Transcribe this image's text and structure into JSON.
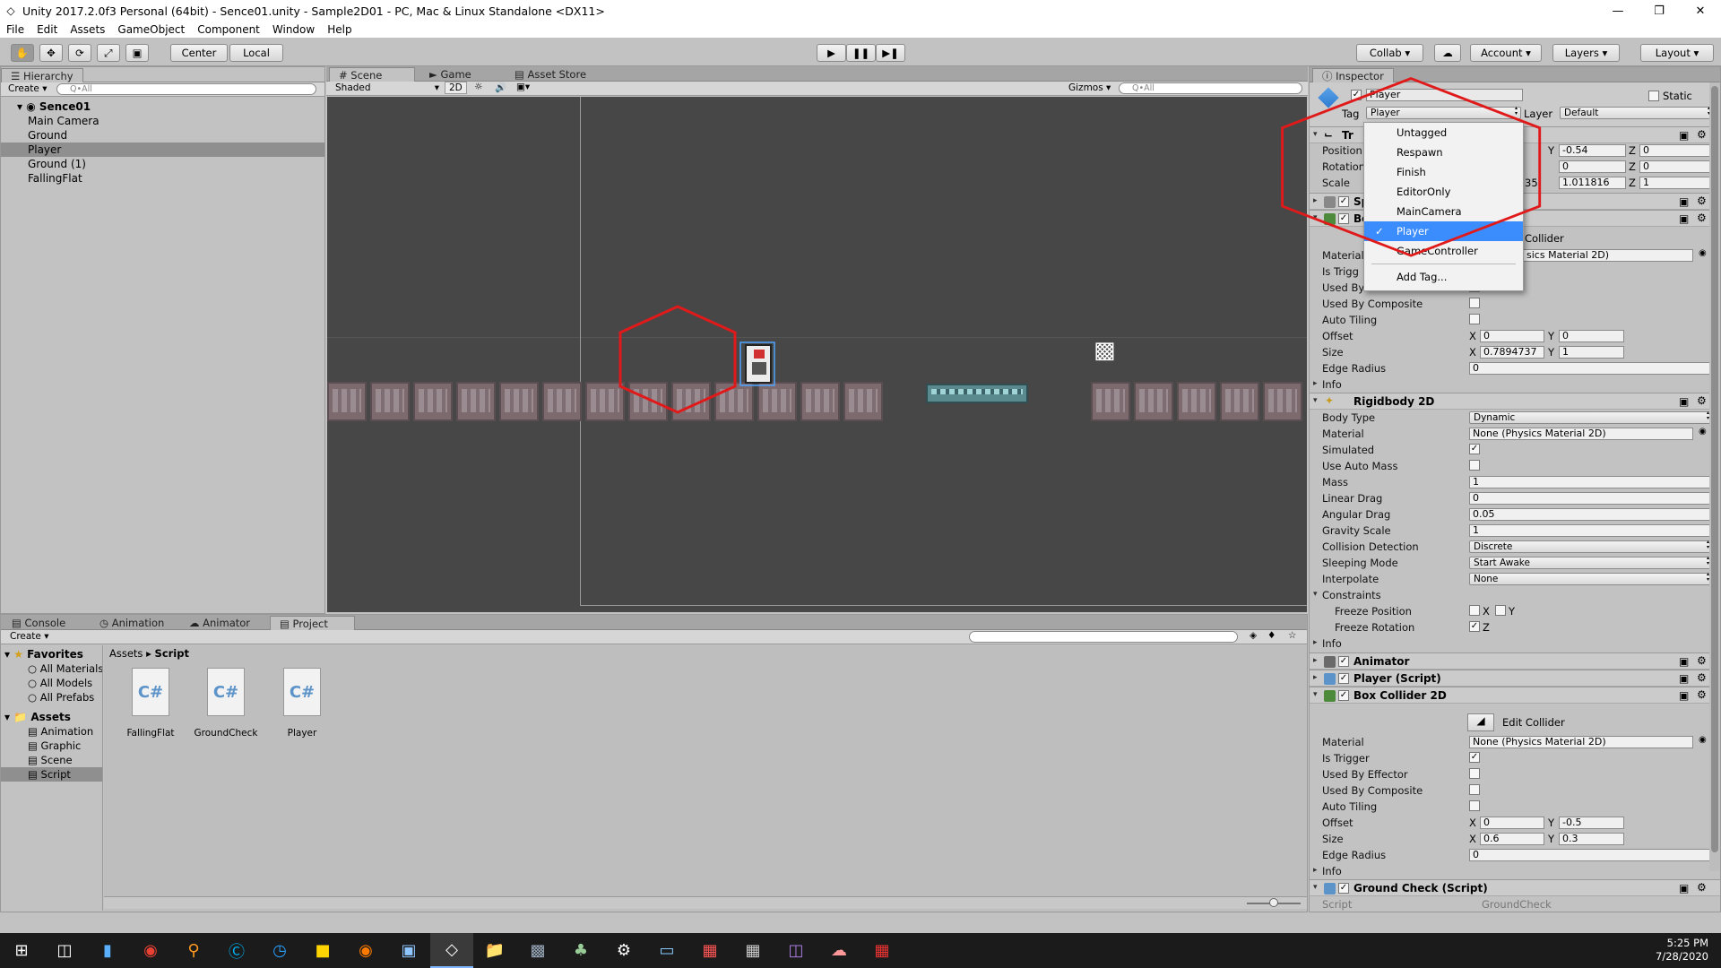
{
  "window": {
    "title": "Unity 2017.2.0f3 Personal (64bit) - Sence01.unity - Sample2D01 - PC, Mac & Linux Standalone <DX11>"
  },
  "menu": [
    "File",
    "Edit",
    "Assets",
    "GameObject",
    "Component",
    "Window",
    "Help"
  ],
  "toolbar": {
    "center": "Center",
    "local": "Local",
    "collab": "Collab",
    "account": "Account",
    "layers": "Layers",
    "layout": "Layout"
  },
  "hierarchy": {
    "tab": "Hierarchy",
    "create": "Create",
    "search": "Q•All",
    "scene": "Sence01",
    "items": [
      "Main Camera",
      "Ground",
      "Player",
      "Ground (1)",
      "FallingFlat"
    ]
  },
  "scene": {
    "tabs": [
      "Scene",
      "Game",
      "Asset Store"
    ],
    "shaded": "Shaded",
    "mode2d": "2D",
    "gizmos": "Gizmos",
    "search": "Q•All"
  },
  "inspector": {
    "tab": "Inspector",
    "object_name": "Player",
    "static": "Static",
    "tag_label": "Tag",
    "tag_value": "Player",
    "layer_label": "Layer",
    "layer_value": "Default",
    "transform": {
      "title": "Tr",
      "position": "Position",
      "rotation": "Rotation",
      "scale": "Scale",
      "pos_y": "-0.54",
      "pos_z": "0",
      "rot_y": "0",
      "rot_z": "0",
      "scale_x": "35",
      "scale_y": "1.011816",
      "scale_z": "1"
    },
    "sprite_title": "Sp",
    "box_title": "Bo",
    "edit_collider_partial": "Collider",
    "box1": {
      "material": "Material",
      "material_val": "sics Material 2D)",
      "is_trigger": "Is Trigg",
      "used_by_effector": "Used By Effector",
      "used_by_composite": "Used By Composite",
      "auto_tiling": "Auto Tiling",
      "offset": "Offset",
      "off_x": "0",
      "off_y": "0",
      "size": "Size",
      "size_x": "0.7894737",
      "size_y": "1",
      "edge_radius": "Edge Radius",
      "edge_val": "0",
      "info": "Info"
    },
    "rigidbody": {
      "title": "Rigidbody 2D",
      "body_type": "Body Type",
      "body_type_val": "Dynamic",
      "material": "Material",
      "material_val": "None (Physics Material 2D)",
      "simulated": "Simulated",
      "use_auto_mass": "Use Auto Mass",
      "mass": "Mass",
      "mass_val": "1",
      "linear_drag": "Linear Drag",
      "linear_drag_val": "0",
      "angular_drag": "Angular Drag",
      "angular_drag_val": "0.05",
      "gravity_scale": "Gravity Scale",
      "gravity_val": "1",
      "collision_detection": "Collision Detection",
      "collision_val": "Discrete",
      "sleeping_mode": "Sleeping Mode",
      "sleeping_val": "Start Awake",
      "interpolate": "Interpolate",
      "interpolate_val": "None",
      "constraints": "Constraints",
      "freeze_position": "Freeze Position",
      "freeze_rotation": "Freeze Rotation",
      "x": "X",
      "y": "Y",
      "z": "Z",
      "info": "Info"
    },
    "animator_title": "Animator",
    "player_script_title": "Player (Script)",
    "box2": {
      "title": "Box Collider 2D",
      "edit_collider": "Edit Collider",
      "material": "Material",
      "material_val": "None (Physics Material 2D)",
      "is_trigger": "Is Trigger",
      "used_by_effector": "Used By Effector",
      "used_by_composite": "Used By Composite",
      "auto_tiling": "Auto Tiling",
      "offset": "Offset",
      "off_x": "0",
      "off_y": "-0.5",
      "size": "Size",
      "size_x": "0.6",
      "size_y": "0.3",
      "edge_radius": "Edge Radius",
      "edge_val": "0",
      "info": "Info"
    },
    "ground_check": {
      "title": "Ground Check (Script)",
      "script": "Script",
      "script_val": "GroundCheck"
    }
  },
  "tag_menu": {
    "items": [
      "Untagged",
      "Respawn",
      "Finish",
      "EditorOnly",
      "MainCamera",
      "Player",
      "GameController"
    ],
    "add": "Add Tag...",
    "selected": "Player"
  },
  "bottom": {
    "tabs": [
      "Console",
      "Animation",
      "Animator",
      "Project"
    ],
    "create": "Create",
    "favorites": "Favorites",
    "fav_items": [
      "All Materials",
      "All Models",
      "All Prefabs"
    ],
    "assets": "Assets",
    "asset_folders": [
      "Animation",
      "Graphic",
      "Scene",
      "Script"
    ],
    "breadcrumb": [
      "Assets",
      "Script"
    ],
    "files": [
      "FallingFlat",
      "GroundCheck",
      "Player"
    ],
    "cs": "C#"
  },
  "taskbar": {
    "time": "5:25 PM",
    "date": "7/28/2020"
  }
}
